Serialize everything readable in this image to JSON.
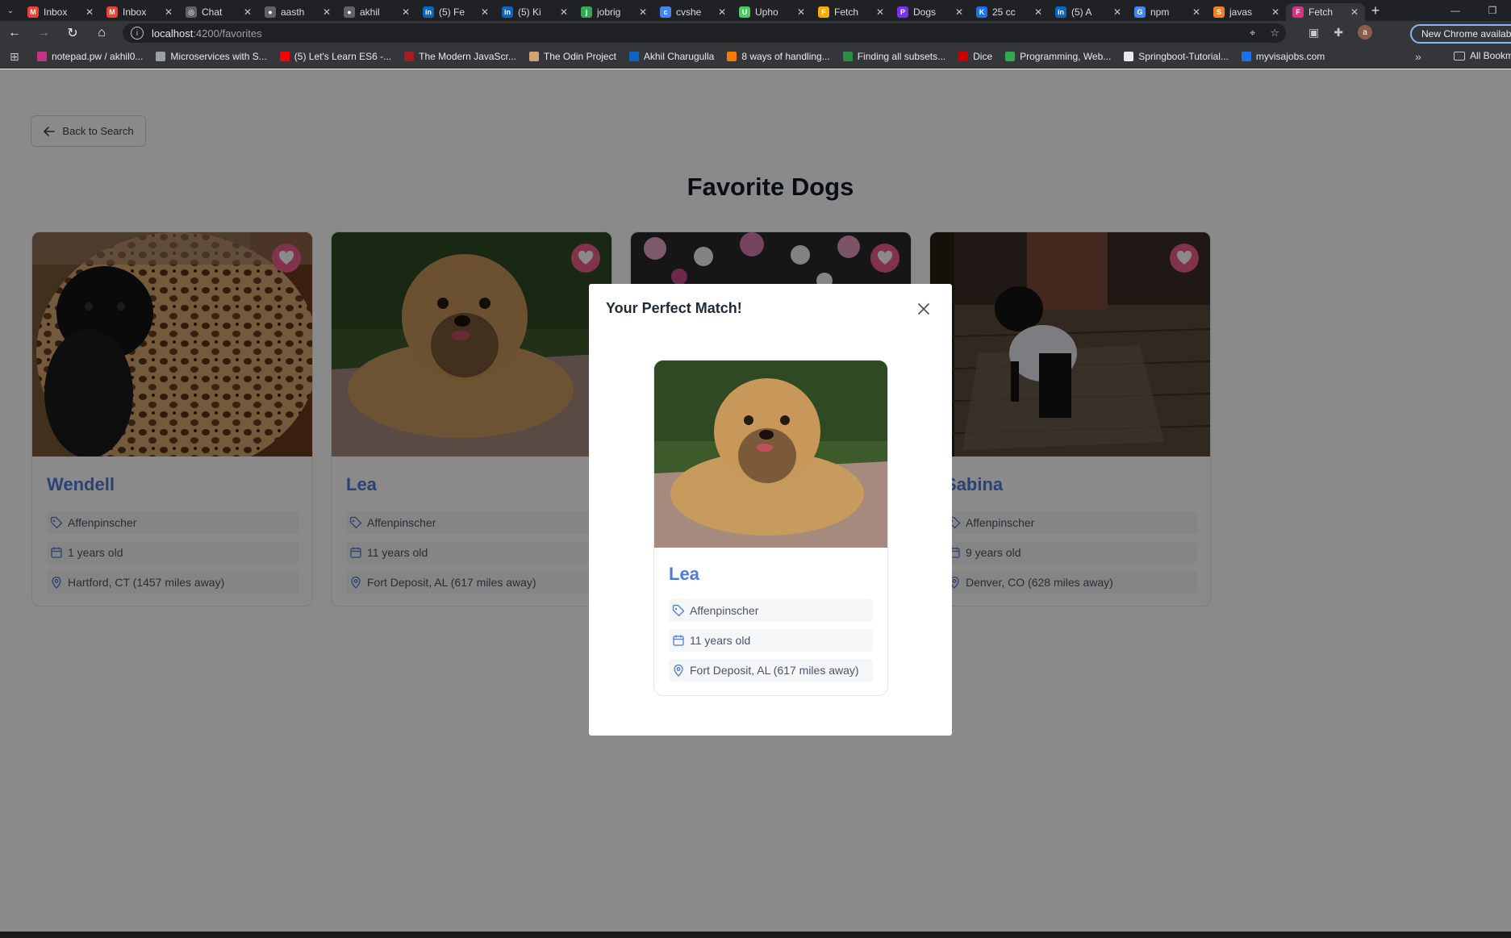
{
  "browser": {
    "tabs": [
      {
        "label": "Inbox",
        "icon": "gmail-icon",
        "color": "#ea4335",
        "glyph": "M"
      },
      {
        "label": "Inbox",
        "icon": "gmail-icon",
        "color": "#ea4335",
        "glyph": "M"
      },
      {
        "label": "Chat",
        "icon": "chatgpt-icon",
        "color": "#5f6368",
        "glyph": "◎"
      },
      {
        "label": "aasth",
        "icon": "github-icon",
        "color": "#5f6368",
        "glyph": "●"
      },
      {
        "label": "akhil",
        "icon": "github-icon",
        "color": "#5f6368",
        "glyph": "●"
      },
      {
        "label": "(5) Fe",
        "icon": "linkedin-icon",
        "color": "#0a66c2",
        "glyph": "in"
      },
      {
        "label": "(5) Ki",
        "icon": "linkedin-icon",
        "color": "#0a66c2",
        "glyph": "in"
      },
      {
        "label": "jobrig",
        "icon": "jobright-icon",
        "color": "#34a853",
        "glyph": "j"
      },
      {
        "label": "cvshe",
        "icon": "cvshelf-icon",
        "color": "#4285f4",
        "glyph": "c"
      },
      {
        "label": "Upho",
        "icon": "uphold-icon",
        "color": "#49cc68",
        "glyph": "U"
      },
      {
        "label": "Fetch",
        "icon": "fetch-icon",
        "color": "#f9ab00",
        "glyph": "F"
      },
      {
        "label": "Dogs",
        "icon": "dogs-icon",
        "color": "#7b2ff7",
        "glyph": "P"
      },
      {
        "label": "25 cc",
        "icon": "k-icon",
        "color": "#1a73e8",
        "glyph": "K"
      },
      {
        "label": "(5) A",
        "icon": "linkedin-icon",
        "color": "#0a66c2",
        "glyph": "in"
      },
      {
        "label": "npm",
        "icon": "google-icon",
        "color": "#4285f4",
        "glyph": "G"
      },
      {
        "label": "javas",
        "icon": "stackoverflow-icon",
        "color": "#f48024",
        "glyph": "S"
      },
      {
        "label": "Fetch",
        "icon": "fetch-icon",
        "color": "#d63384",
        "glyph": "F",
        "active": true
      }
    ],
    "url_host": "localhost",
    "url_path": ":4200/favorites",
    "update_label": "New Chrome available",
    "profile_initial": "a",
    "bookmarks": [
      {
        "label": "notepad.pw / akhil0...",
        "color": "#c13584"
      },
      {
        "label": "Microservices with S...",
        "color": "#9aa0a6"
      },
      {
        "label": "(5) Let's Learn ES6 -...",
        "color": "#ff0000"
      },
      {
        "label": "The Modern JavaScr...",
        "color": "#a61d24"
      },
      {
        "label": "The Odin Project",
        "color": "#d4a373"
      },
      {
        "label": "Akhil Charugulla",
        "color": "#0a66c2"
      },
      {
        "label": "8 ways of handling...",
        "color": "#f57c00"
      },
      {
        "label": "Finding all subsets...",
        "color": "#2f8d46"
      },
      {
        "label": "Dice",
        "color": "#cc0000"
      },
      {
        "label": "Programming, Web...",
        "color": "#34a853"
      },
      {
        "label": "Springboot-Tutorial...",
        "color": "#e8eaed"
      },
      {
        "label": "myvisajobs.com",
        "color": "#1a73e8"
      }
    ],
    "all_bookmarks_label": "All Bookmarks"
  },
  "page": {
    "back_label": "Back to Search",
    "title": "Favorite Dogs"
  },
  "favorites": [
    {
      "name": "Wendell",
      "breed": "Affenpinscher",
      "age": "1 years old",
      "location": "Hartford, CT (1457 miles away)",
      "photo": "black-dog-on-leopard-bed"
    },
    {
      "name": "Lea",
      "breed": "Affenpinscher",
      "age": "11 years old",
      "location": "Fort Deposit, AL (617 miles away)",
      "photo": "tan-dog-on-patio"
    },
    {
      "name": "",
      "breed": "",
      "age": "",
      "location": "",
      "photo": "dog-with-flowers"
    },
    {
      "name": "Sabina",
      "breed": "Affenpinscher",
      "age": "9 years old",
      "location": "Denver, CO (628 miles away)",
      "photo": "black-dog-on-deck"
    }
  ],
  "modal": {
    "title": "Your Perfect Match!",
    "match": {
      "name": "Lea",
      "breed": "Affenpinscher",
      "age": "11 years old",
      "location": "Fort Deposit, AL (617 miles away)",
      "photo": "tan-dog-on-patio"
    }
  },
  "colors": {
    "accent": "#4f7bd9",
    "heart": "#ec5f8b"
  }
}
